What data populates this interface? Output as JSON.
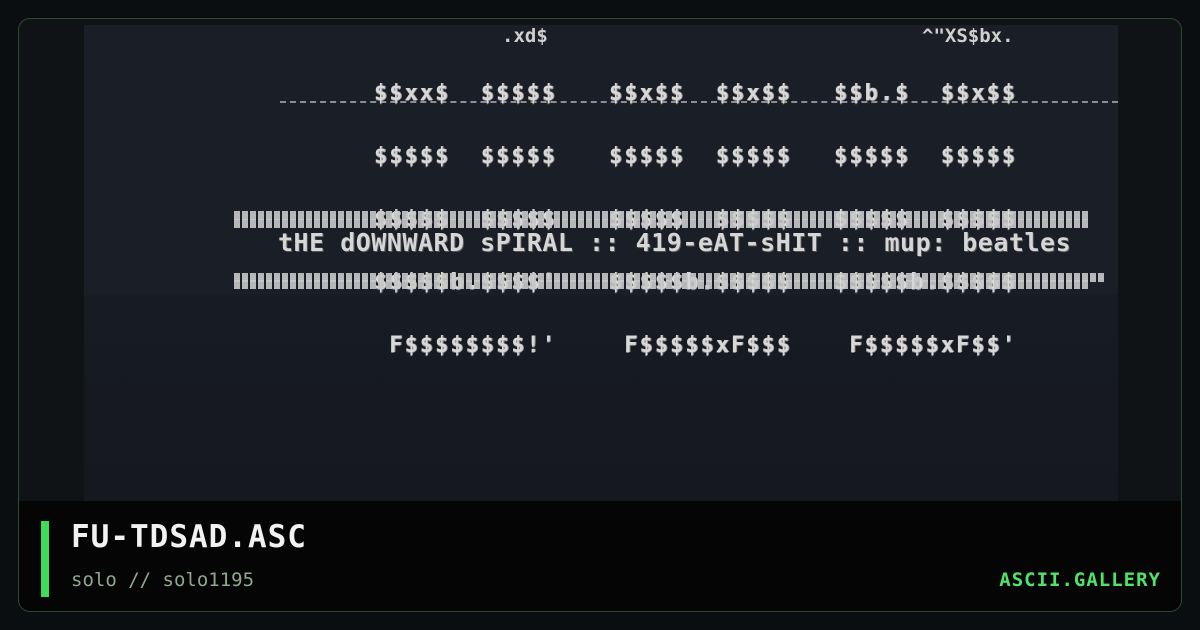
{
  "artwork": {
    "logo_rows": [
      [
        "$$xx$  $$$$$",
        "$$x$$  $$x$$",
        "$$b.$  $$x$$"
      ],
      [
        "$$$$$  $$$$$",
        "$$$$$  $$$$$",
        "$$$$$  $$$$$"
      ],
      [
        "$$$$$  $$$$$",
        "$$$$$  $$$$$",
        "$$$$$  $$$$$"
      ],
      [
        "$$$$$b.$$$$'",
        "$$$$$b.$$$$$",
        "$$$$$b.$$$$$"
      ],
      [
        " F$$$$$$$$!'",
        " F$$$$$xF$$$",
        " F$$$$$xF$$'"
      ]
    ],
    "fragment_left": ".xd$",
    "fragment_right": "^\"XS$bx.",
    "tagline": "tHE dOWNWARD sPIRAL :: 419-eAT-sHIT :: mup: beatles"
  },
  "footer": {
    "title": "FU-TDSAD.ASC",
    "author": "solo // solo1195",
    "brand": "ASCII.GALLERY"
  },
  "colors": {
    "accent": "#3fdc5a",
    "brand": "#4fe36a",
    "background": "#0b0e10",
    "footer_bg": "#050505"
  }
}
